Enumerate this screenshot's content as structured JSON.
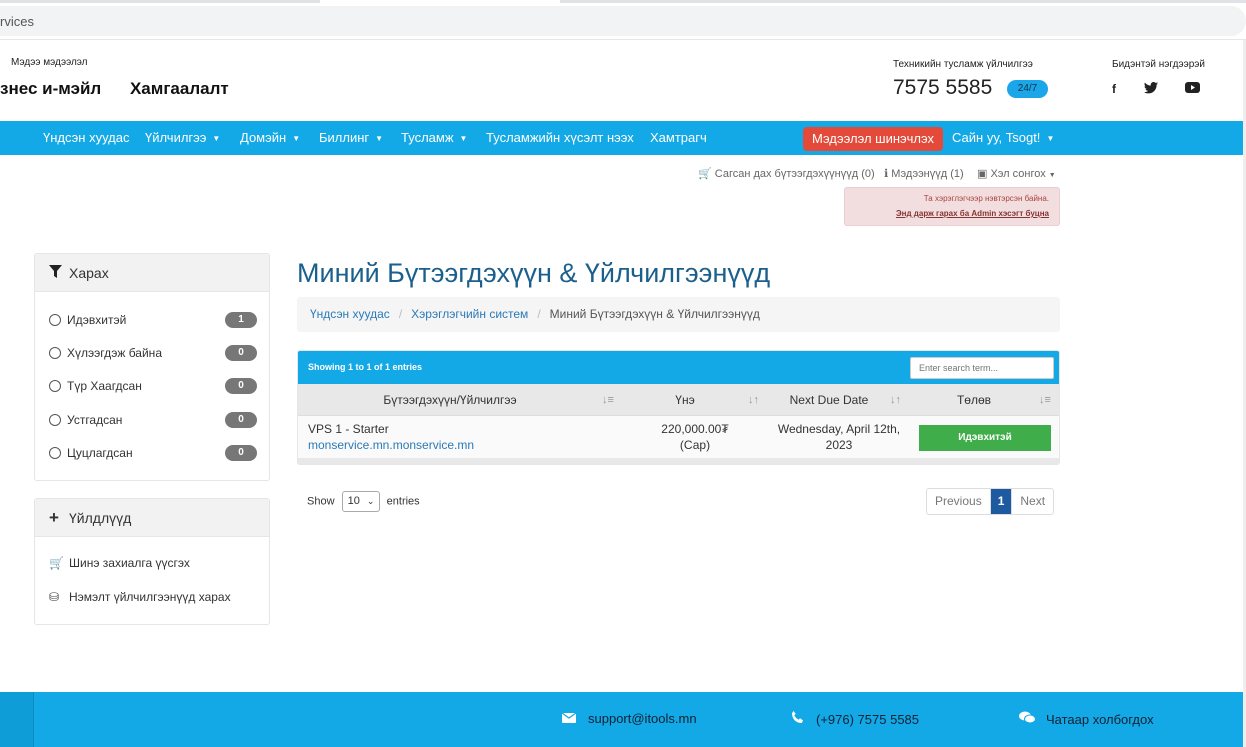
{
  "browser": {
    "url": "rvices"
  },
  "header": {
    "news_label": "Мэдээ мэдээлэл",
    "links": [
      "знес и-мэйл",
      "Хамгаалалт"
    ],
    "support_label": "Техникийн тусламж үйлчилгээ",
    "support_phone": "7575 5585",
    "support_badge": "24/7",
    "connect_label": "Бидэнтэй нэгдээрэй",
    "social_icons": [
      "facebook-icon",
      "twitter-icon",
      "youtube-icon"
    ]
  },
  "nav": {
    "items": [
      {
        "label": "Үндсэн хуудас",
        "caret": false
      },
      {
        "label": "Үйлчилгээ",
        "caret": true
      },
      {
        "label": "Домэйн",
        "caret": true
      },
      {
        "label": "Биллинг",
        "caret": true
      },
      {
        "label": "Тусламж",
        "caret": true
      },
      {
        "label": "Тусламжийн хүсэлт нээх",
        "caret": false
      },
      {
        "label": "Хамтрагч",
        "caret": false
      }
    ],
    "update_button": "Мэдээлэл шинэчлэх",
    "greeting": "Сайн уу, Tsogt!"
  },
  "utility": {
    "cart": "Сагсан дах бүтээгдэхүүнүүд (0)",
    "notifications": "Мэдээнүүд (1)",
    "language": "Хэл сонгох"
  },
  "alert": {
    "line1": "Та хэрэглэгчээр нэвтэрсэн байна.",
    "line2": "Энд дарж гарах ба Admin хэсэгт буцна"
  },
  "sidebar": {
    "filter_title": "Харах",
    "filters": [
      {
        "label": "Идэвхитэй",
        "count": "1"
      },
      {
        "label": "Хүлээгдэж байна",
        "count": "0"
      },
      {
        "label": "Түр Хаагдсан",
        "count": "0"
      },
      {
        "label": "Устгадсан",
        "count": "0"
      },
      {
        "label": "Цуцлагдсан",
        "count": "0"
      }
    ],
    "actions_title": "Үйлдлүүд",
    "actions": [
      {
        "label": "Шинэ захиалга үүсгэх",
        "icon": "cart-icon"
      },
      {
        "label": "Нэмэлт үйлчилгээнүүд харах",
        "icon": "cubes-icon"
      }
    ]
  },
  "main": {
    "title": "Миний Бүтээгдэхүүн & Үйлчилгээнүүд",
    "breadcrumb": [
      "Үндсэн хуудас",
      "Хэрэглэгчийн систем",
      "Миний Бүтээгдэхүүн & Үйлчилгээнүүд"
    ],
    "table": {
      "info": "Showing 1 to 1 of 1 entries",
      "search_placeholder": "Enter search term...",
      "columns": [
        "Бүтээгдэхүүн/Үйлчилгээ",
        "Үнэ",
        "Next Due Date",
        "Төлөв"
      ],
      "rows": [
        {
          "product": "VPS 1 - Starter",
          "domain": "monservice.mn.monservice.mn",
          "price": "220,000.00₮",
          "cycle": "(Сар)",
          "due_line1": "Wednesday, April 12th,",
          "due_line2": "2023",
          "status": "Идэвхитэй"
        }
      ]
    },
    "show_label": "Show",
    "show_value": "10",
    "entries_label": "entries",
    "pager": {
      "prev": "Previous",
      "page": "1",
      "next": "Next"
    }
  },
  "footer": {
    "email": "support@itools.mn",
    "phone": "(+976) 7575 5585",
    "chat": "Чатаар холбогдох"
  },
  "colors": {
    "primary": "#13a8e6",
    "danger": "#e44a3a",
    "success": "#3fae4a",
    "title": "#1b5f8c"
  }
}
